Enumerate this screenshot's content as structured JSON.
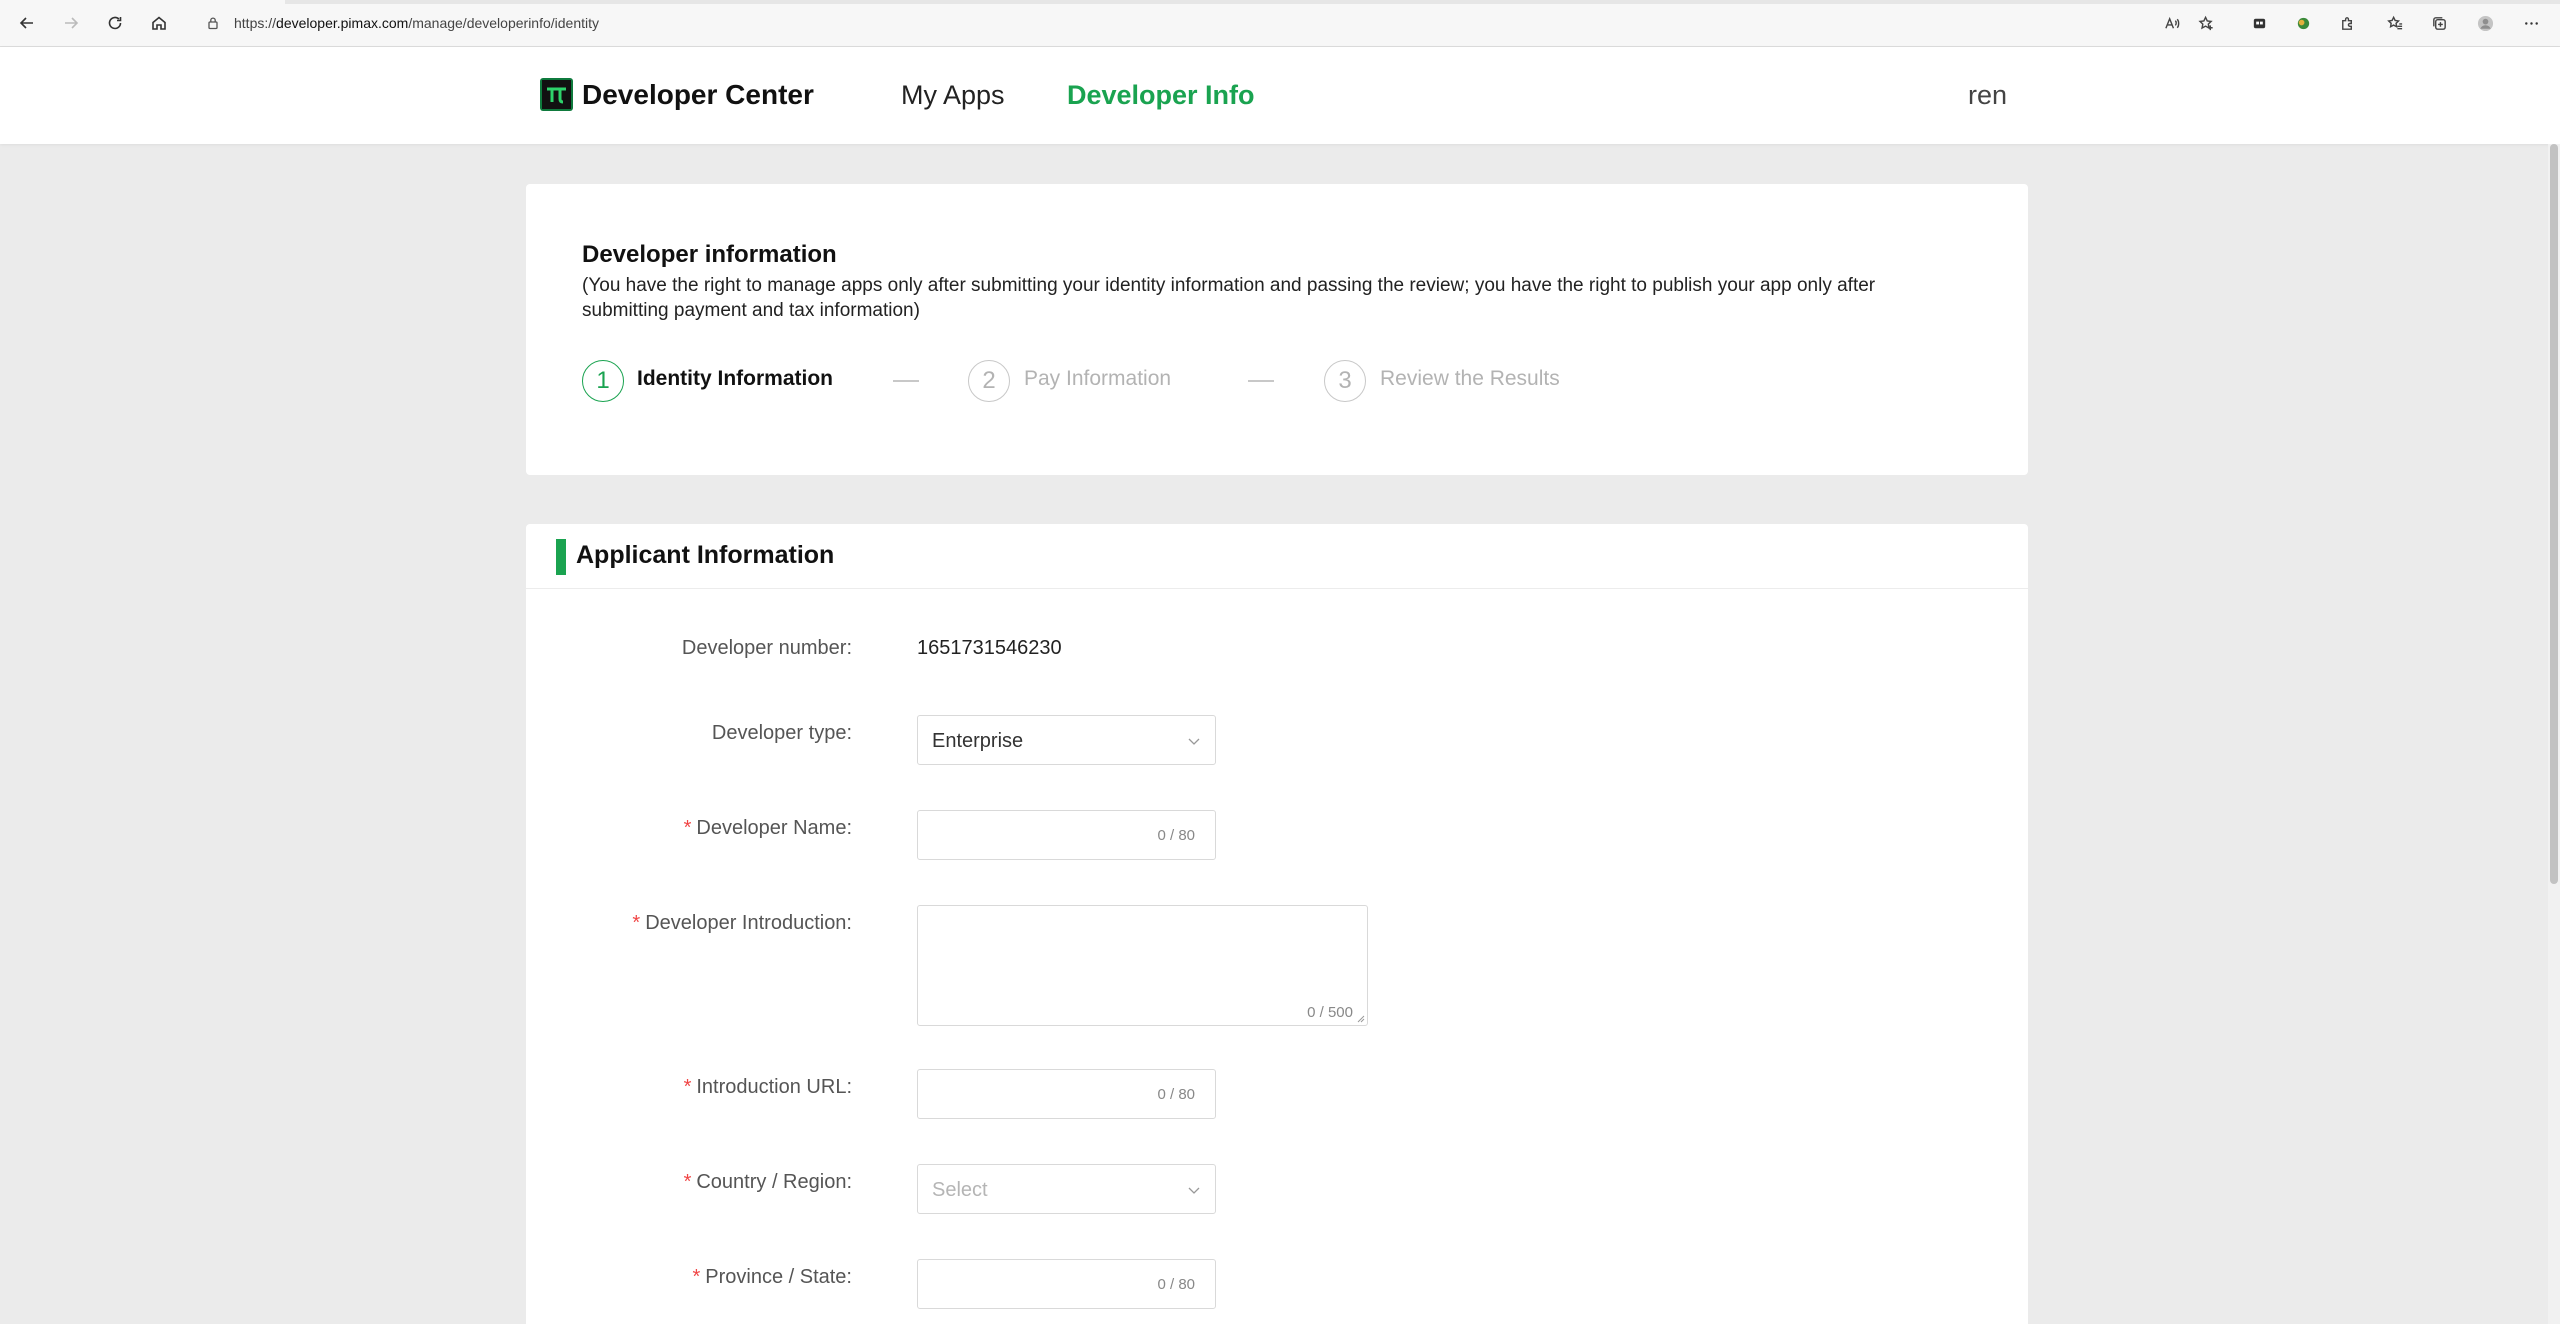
{
  "browser": {
    "url_prefix": "https://",
    "url_host": "developer.pimax.com",
    "url_path": "/manage/developerinfo/identity"
  },
  "header": {
    "brand": "Developer Center",
    "nav": {
      "my_apps": "My Apps",
      "developer_info": "Developer Info"
    },
    "user": "ren",
    "accent_color": "#1aa350"
  },
  "info_card": {
    "title": "Developer information",
    "description": "(You have the right to manage apps only after submitting your identity information and passing the review; you have the right to publish your app only after submitting payment and tax information)",
    "steps": [
      {
        "number": "1",
        "label": "Identity Information",
        "active": true
      },
      {
        "number": "2",
        "label": "Pay Information",
        "active": false
      },
      {
        "number": "3",
        "label": "Review the Results",
        "active": false
      }
    ]
  },
  "form": {
    "section_title": "Applicant Information",
    "developer_number": {
      "label": "Developer number:",
      "value": "1651731546230"
    },
    "developer_type": {
      "label": "Developer type:",
      "value": "Enterprise"
    },
    "developer_name": {
      "required": "*",
      "label": "Developer Name:",
      "counter": "0 / 80"
    },
    "developer_intro": {
      "required": "*",
      "label": "Developer Introduction:",
      "counter": "0 / 500"
    },
    "intro_url": {
      "required": "*",
      "label": "Introduction URL:",
      "counter": "0 / 80"
    },
    "country": {
      "required": "*",
      "label": "Country / Region:",
      "placeholder": "Select"
    },
    "province": {
      "required": "*",
      "label": "Province / State:",
      "counter": "0 / 80"
    }
  }
}
